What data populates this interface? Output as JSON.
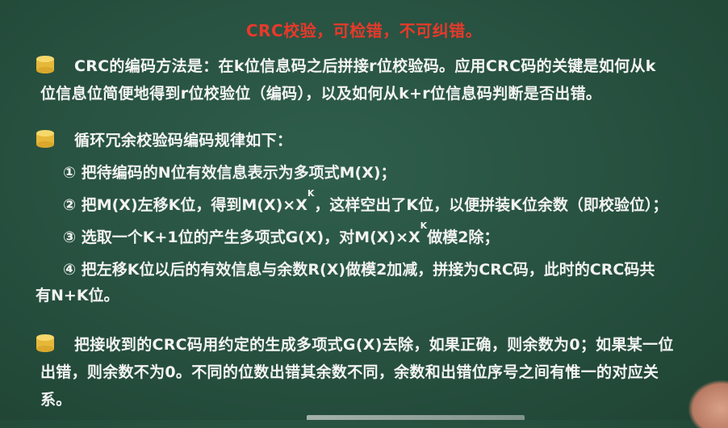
{
  "title": "CRC校验，可检错，不可纠错。",
  "section1": {
    "line1": "CRC的编码方法是：在k位信息码之后拼接r位校验码。应用CRC码的关键是如何从k",
    "line2": "位信息位简便地得到r位校验位（编码），以及如何从k+r位信息码判断是否出错。"
  },
  "section2": {
    "heading": "循环冗余校验码编码规律如下：",
    "item1": "① 把待编码的N位有效信息表示为多项式M(X)；",
    "item2_pre": "② 把M(X)左移K位，得到M(X)×X",
    "item2_sup": "K",
    "item2_post": "，这样空出了K位，以便拼装K位余数（即校验位）；",
    "item3_pre": "③ 选取一个K+1位的产生多项式G(X)，对M(X)×X",
    "item3_sup": "K",
    "item3_post": "做模2除；",
    "item4_line1": "④ 把左移K位以后的有效信息与余数R(X)做模2加减，拼接为CRC码，此时的CRC码共",
    "item4_line2": "有N+K位。"
  },
  "section3": {
    "line1": "把接收到的CRC码用约定的生成多项式G(X)去除，如果正确，则余数为0；如果某一位",
    "line2": "出错，则余数不为0。不同的位数出错其余数不同，余数和出错位序号之间有惟一的对应关",
    "line3": "系。"
  },
  "colors": {
    "background": "#2a5644",
    "title": "#e8392b",
    "bullet": "#f0c94a",
    "text": "#f4f4f4"
  },
  "icons": {
    "bullet": "database-cylinder-icon"
  }
}
